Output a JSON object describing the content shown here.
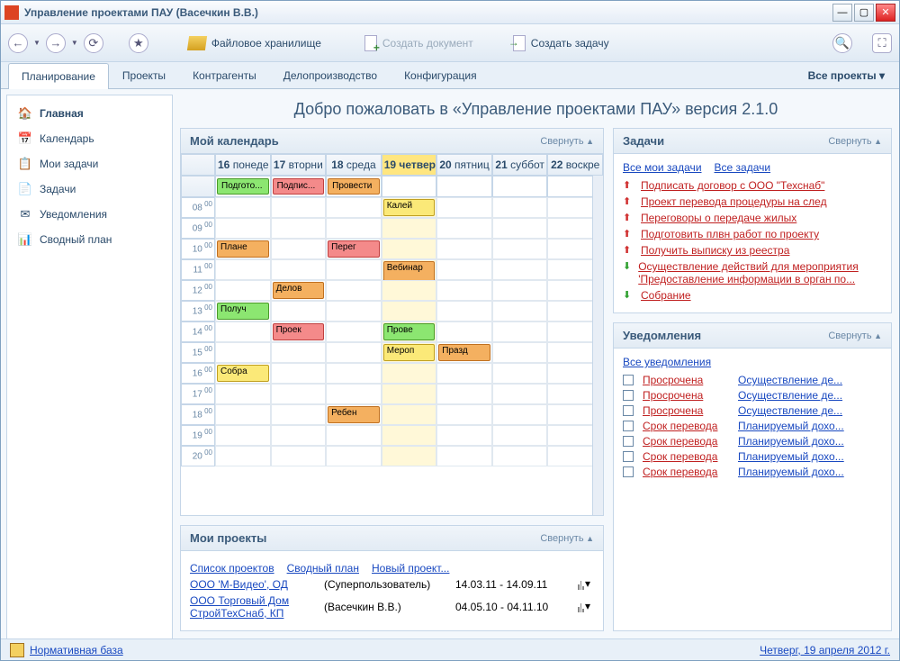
{
  "window": {
    "title": "Управление проектами ПАУ (Васечкин В.В.)"
  },
  "toolbar": {
    "storage": "Файловое хранилище",
    "create_doc": "Создать документ",
    "create_task": "Создать задачу"
  },
  "tabs": {
    "items": [
      {
        "label": "Планирование",
        "active": true
      },
      {
        "label": "Проекты"
      },
      {
        "label": "Контрагенты"
      },
      {
        "label": "Делопроизводство"
      },
      {
        "label": "Конфигурация"
      }
    ],
    "right": "Все проекты"
  },
  "sidebar": {
    "items": [
      {
        "label": "Главная",
        "icon": "🏠",
        "active": true
      },
      {
        "label": "Календарь",
        "icon": "📅"
      },
      {
        "label": "Мои задачи",
        "icon": "📋"
      },
      {
        "label": "Задачи",
        "icon": "📄"
      },
      {
        "label": "Уведомления",
        "icon": "✉"
      },
      {
        "label": "Сводный план",
        "icon": "📊"
      }
    ]
  },
  "welcome": "Добро пожаловать в «Управление проектами ПАУ» версия 2.1.0",
  "collapse_label": "Свернуть",
  "calendar": {
    "title": "Мой календарь",
    "days": [
      {
        "num": "16",
        "name": "понеде"
      },
      {
        "num": "17",
        "name": "вторни"
      },
      {
        "num": "18",
        "name": "среда"
      },
      {
        "num": "19",
        "name": "четвер",
        "sel": true
      },
      {
        "num": "20",
        "name": "пятниц"
      },
      {
        "num": "21",
        "name": "суббот"
      },
      {
        "num": "22",
        "name": "воскре"
      }
    ],
    "hours": [
      "08",
      "09",
      "10",
      "11",
      "12",
      "13",
      "14",
      "15",
      "16",
      "17",
      "18",
      "19",
      "20"
    ],
    "allday": [
      {
        "day": 0,
        "label": "Подгото...",
        "cls": "ev-green"
      },
      {
        "day": 1,
        "label": "Подпис...",
        "cls": "ev-red"
      },
      {
        "day": 2,
        "label": "Провести",
        "cls": "ev-orange"
      }
    ],
    "events": [
      {
        "day": 3,
        "hour": 0,
        "label": "Калей",
        "cls": "ev-yellow"
      },
      {
        "day": 2,
        "hour": 2,
        "label": "Перег",
        "cls": "ev-red"
      },
      {
        "day": 0,
        "hour": 2,
        "label": "Плане",
        "cls": "ev-orange"
      },
      {
        "day": 3,
        "hour": 3,
        "label": "Вебинар",
        "cls": "ev-orange",
        "dbl": true
      },
      {
        "day": 1,
        "hour": 4,
        "label": "Делов",
        "cls": "ev-orange"
      },
      {
        "day": 0,
        "hour": 5,
        "label": "Получ",
        "cls": "ev-green"
      },
      {
        "day": 1,
        "hour": 6,
        "label": "Проек",
        "cls": "ev-red"
      },
      {
        "day": 3,
        "hour": 6,
        "label": "Прове",
        "cls": "ev-green"
      },
      {
        "day": 3,
        "hour": 7,
        "label": "Мероп",
        "cls": "ev-yellow"
      },
      {
        "day": 4,
        "hour": 7,
        "label": "Празд",
        "cls": "ev-orange"
      },
      {
        "day": 0,
        "hour": 8,
        "label": "Собра",
        "cls": "ev-yellow"
      },
      {
        "day": 2,
        "hour": 10,
        "label": "Ребен",
        "cls": "ev-orange"
      }
    ]
  },
  "projects": {
    "title": "Мои проекты",
    "links": [
      "Список проектов",
      "Сводный план",
      "Новый проект..."
    ],
    "rows": [
      {
        "name": "ООО 'М-Видео', ОД",
        "owner": "(Суперпользователь)",
        "dates": "14.03.11 - 14.09.11"
      },
      {
        "name": "ООО Торговый Дом СтройТехСнаб, КП",
        "owner": "(Васечкин В.В.)",
        "dates": "04.05.10 - 04.11.10"
      }
    ]
  },
  "tasks": {
    "title": "Задачи",
    "links": [
      "Все мои задачи",
      "Все задачи"
    ],
    "items": [
      {
        "dir": "up",
        "label": "Подписать договор с ООО \"Техснаб\""
      },
      {
        "dir": "up",
        "label": "Проект перевода процедуры на след"
      },
      {
        "dir": "up",
        "label": "Переговоры о передаче жилых"
      },
      {
        "dir": "up",
        "label": "Подготовить плвн работ по проекту"
      },
      {
        "dir": "up",
        "label": "Получить выписку из реестра"
      },
      {
        "dir": "dn",
        "label": "Осуществление действий для мероприятия 'Предоставление информации в орган по..."
      },
      {
        "dir": "dn",
        "label": "Собрание"
      }
    ]
  },
  "notifications": {
    "title": "Уведомления",
    "all_link": "Все уведомления",
    "items": [
      {
        "status": "Просрочена",
        "label": "Осуществление де..."
      },
      {
        "status": "Просрочена",
        "label": "Осуществление де..."
      },
      {
        "status": "Просрочена",
        "label": "Осуществление де..."
      },
      {
        "status": "Срок перевода",
        "label": "Планируемый дохо..."
      },
      {
        "status": "Срок перевода",
        "label": "Планируемый дохо..."
      },
      {
        "status": "Срок перевода",
        "label": "Планируемый дохо..."
      },
      {
        "status": "Срок перевода",
        "label": "Планируемый дохо..."
      }
    ]
  },
  "footer": {
    "left": "Нормативная база",
    "right": "Четверг, 19 апреля 2012 г."
  }
}
